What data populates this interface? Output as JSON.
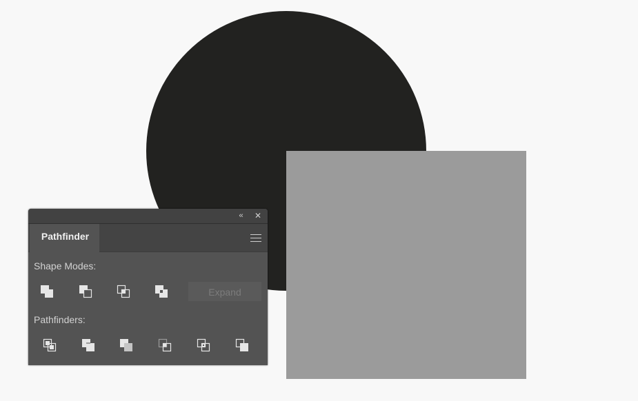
{
  "canvas": {
    "background_color": "#f8f8f8",
    "circle_color": "#222220",
    "square_color": "#9b9b9b"
  },
  "panel": {
    "collapse_glyph": "‹‹",
    "close_glyph": "✕",
    "tab_label": "Pathfinder",
    "shape_modes_label": "Shape Modes:",
    "pathfinders_label": "Pathfinders:",
    "expand_label": "Expand",
    "expand_enabled": false,
    "shape_mode_icons": [
      "unite-icon",
      "minus-front-icon",
      "intersect-icon",
      "exclude-icon"
    ],
    "pathfinder_icons": [
      "divide-icon",
      "trim-icon",
      "merge-icon",
      "crop-icon",
      "outline-icon",
      "minus-back-icon"
    ]
  }
}
